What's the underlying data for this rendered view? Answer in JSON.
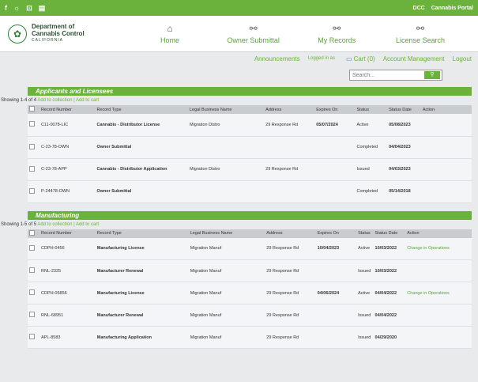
{
  "topbar": {
    "icons": [
      "f",
      "☼",
      "⊡",
      "▤"
    ],
    "right": [
      "DCC",
      "Cannabis Portal"
    ]
  },
  "logo": {
    "line1": "Department of",
    "line2": "Cannabis Control",
    "line3": "CALIFORNIA"
  },
  "nav": [
    {
      "label": "Home",
      "icon": "home-icon"
    },
    {
      "label": "Owner Submittal",
      "icon": "network-icon"
    },
    {
      "label": "My Records",
      "icon": "network-icon"
    },
    {
      "label": "License Search",
      "icon": "network-icon"
    }
  ],
  "links": {
    "announcements": "Announcements",
    "logged_in": "Logged in as",
    "cart": "Cart (0)",
    "account": "Account Management",
    "logout": "Logout"
  },
  "search": {
    "placeholder": "Search..."
  },
  "sections": [
    {
      "title": "Applicants and Licensees",
      "showing": "Showing 1-4 of 4",
      "add_links": "Add to collection | Add to cart",
      "headers": [
        "Record Number",
        "Record Type",
        "Legal Business Name",
        "Address",
        "Expires On",
        "Status",
        "Status Date",
        "Action"
      ],
      "rows": [
        {
          "num": "C11-0078-LIC",
          "type": "Cannabis - Distributor License",
          "name": "Migration Distro",
          "address": "29 Response Rd",
          "expires": "05/07/2024",
          "status": "Active",
          "date": "05/08/2023",
          "action": ""
        },
        {
          "num": "C-23-78-OWN",
          "type": "Owner Submittal",
          "name": "",
          "address": "",
          "expires": "",
          "status": "Completed",
          "date": "04/04/2023",
          "action": ""
        },
        {
          "num": "C-23-78-APP",
          "type": "Cannabis - Distributor Application",
          "name": "Migration Distro",
          "address": "29 Response Rd",
          "expires": "",
          "status": "Issued",
          "date": "04/03/2023",
          "action": ""
        },
        {
          "num": "P-24478-OWN",
          "type": "Owner Submittal",
          "name": "",
          "address": "",
          "expires": "",
          "status": "Completed",
          "date": "05/14/2018",
          "action": ""
        }
      ]
    },
    {
      "title": "Manufacturing",
      "showing": "Showing 1-5 of 5",
      "add_links": "Add to collection | Add to cart",
      "headers": [
        "Record Number",
        "Record Type",
        "Legal Business Name",
        "Address",
        "Expires On",
        "Status",
        "Status Date",
        "Action"
      ],
      "rows": [
        {
          "num": "CDPH-0456",
          "type": "Manufacturing License",
          "name": "Migration Manuf",
          "address": "29 Response Rd",
          "expires": "10/04/2023",
          "status": "Active",
          "date": "10/03/2022",
          "action": "Change in Operations"
        },
        {
          "num": "RNL-2325",
          "type": "Manufacturer Renewal",
          "name": "Migration Manuf",
          "address": "29 Response Rd",
          "expires": "",
          "status": "Issued",
          "date": "10/03/2022",
          "action": ""
        },
        {
          "num": "CDPH-05856",
          "type": "Manufacturing License",
          "name": "Migration Manuf",
          "address": "29 Response Rd",
          "expires": "04/06/2024",
          "status": "Active",
          "date": "04/04/2022",
          "action": "Change in Operations"
        },
        {
          "num": "RNL-68951",
          "type": "Manufacturer Renewal",
          "name": "Migration Manuf",
          "address": "29 Response Rd",
          "expires": "",
          "status": "Issued",
          "date": "04/04/2022",
          "action": ""
        },
        {
          "num": "APL-8583",
          "type": "Manufacturing Application",
          "name": "Migration Manuf",
          "address": "29 Response Rd",
          "expires": "",
          "status": "Issued",
          "date": "04/29/2020",
          "action": ""
        }
      ]
    }
  ]
}
